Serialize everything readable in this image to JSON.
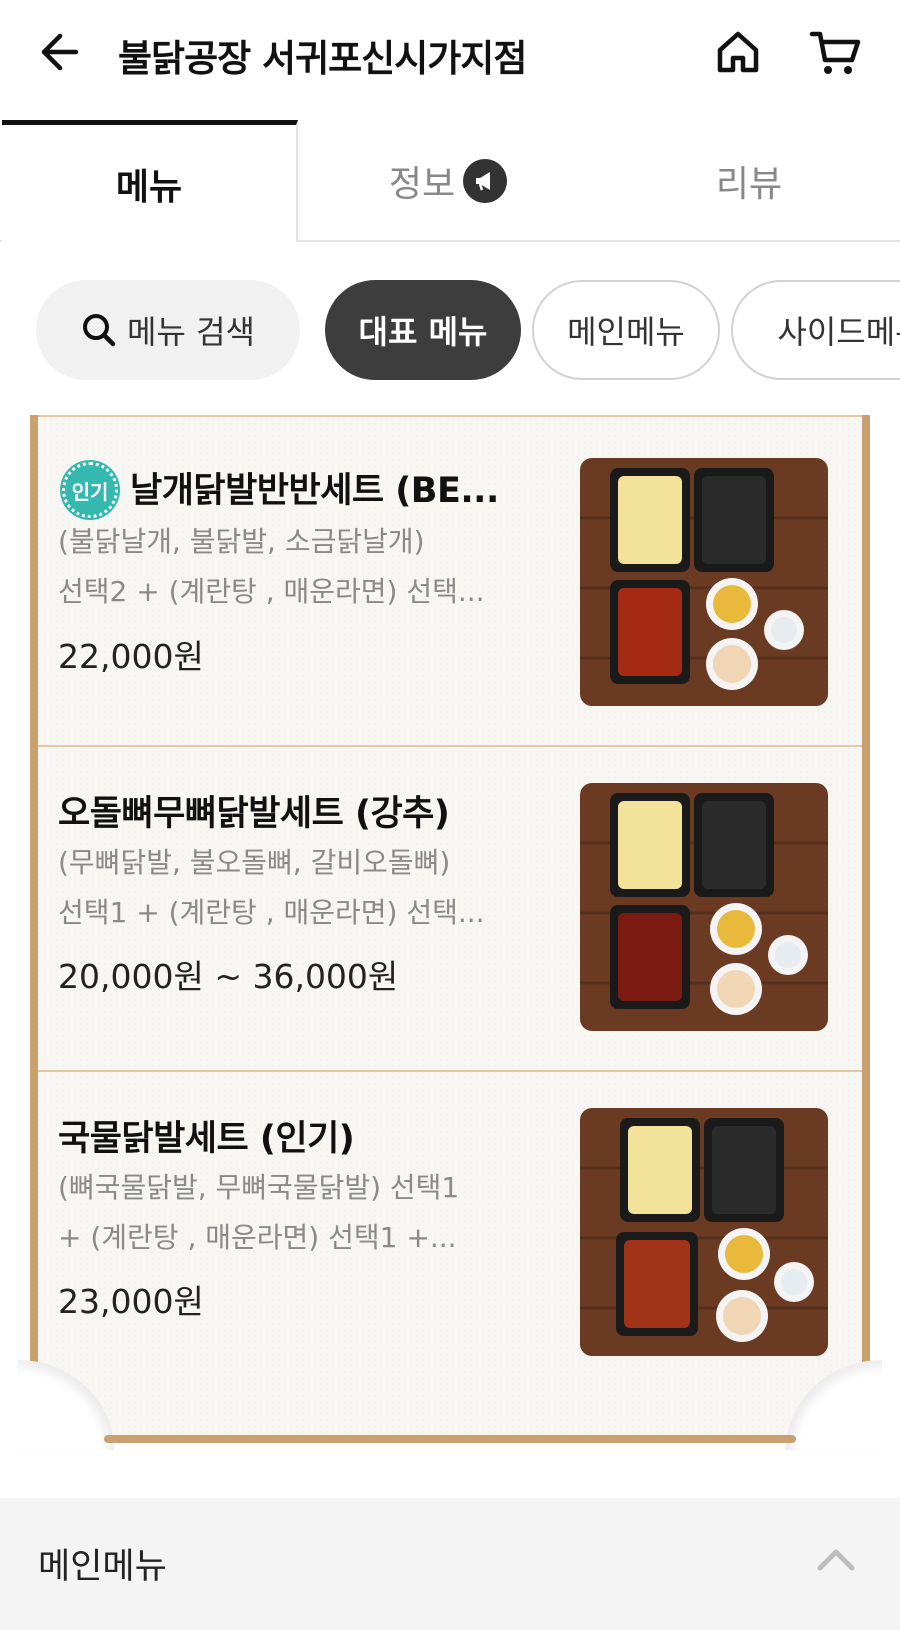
{
  "header": {
    "title": "불닭공장 서귀포신시가지점",
    "back_icon": "arrow-left-icon",
    "home_icon": "home-icon",
    "cart_icon": "cart-icon"
  },
  "tabs": [
    {
      "label": "메뉴",
      "active": true
    },
    {
      "label": "정보",
      "active": false,
      "badge_icon": "megaphone-icon"
    },
    {
      "label": "리뷰",
      "active": false
    }
  ],
  "filters": {
    "search_label": "메뉴 검색",
    "chips": [
      "대표 메뉴",
      "메인메뉴",
      "사이드메뉴"
    ]
  },
  "menu_items": [
    {
      "badge": "인기",
      "name": "날개닭발반반세트 (BE...",
      "desc_lines": [
        "(불닭날개, 불닭발, 소금닭날개)",
        "선택2 + (계란탕 , 매운라면) 선택..."
      ],
      "price": "22,000원"
    },
    {
      "name": "오돌뼈무뼈닭발세트 (강추)",
      "desc_lines": [
        "(무뼈닭발, 불오돌뼈, 갈비오돌뼈)",
        "선택1 + (계란탕 , 매운라면) 선택..."
      ],
      "price": "20,000원 ~ 36,000원"
    },
    {
      "name": "국물닭발세트 (인기)",
      "desc_lines": [
        "(뼈국물닭발, 무뼈국물닭발) 선택1",
        "+ (계란탕 , 매운라면) 선택1 +..."
      ],
      "price": "23,000원"
    }
  ],
  "section": {
    "title": "메인메뉴",
    "toggle_icon": "chevron-up-icon"
  },
  "colors": {
    "accent_dark": "#3d3d3d",
    "frame_wood": "#c9a170",
    "badge_teal": "#35b8b0"
  }
}
